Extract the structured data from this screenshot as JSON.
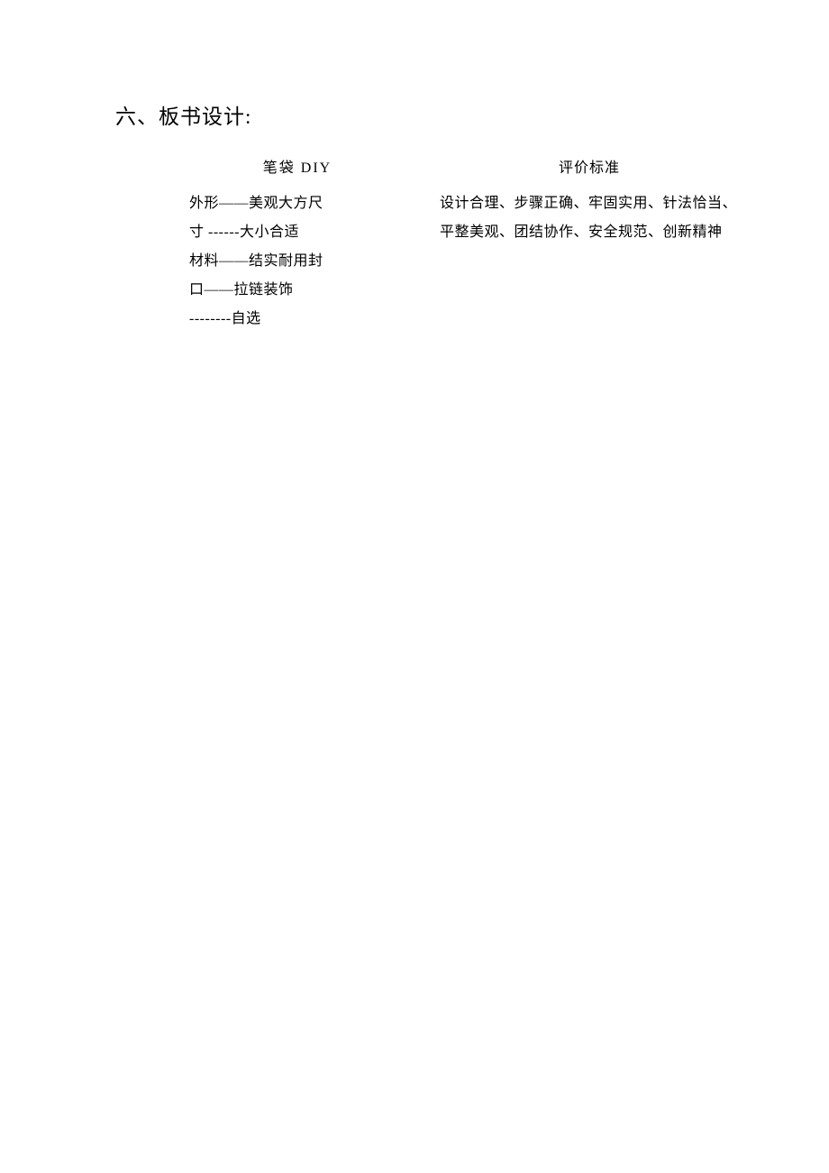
{
  "heading": "六、板书设计:",
  "left": {
    "title": "笔袋 DIY",
    "lines": [
      "外形——美观大方尺",
      "寸 ------大小合适",
      "材料——结实耐用封",
      "口——拉链装饰",
      " --------自选"
    ]
  },
  "right": {
    "title": "评价标准",
    "lines": [
      "设计合理、步骤正确、牢固实用、针法恰当、",
      "平整美观、团结协作、安全规范、创新精神"
    ]
  }
}
